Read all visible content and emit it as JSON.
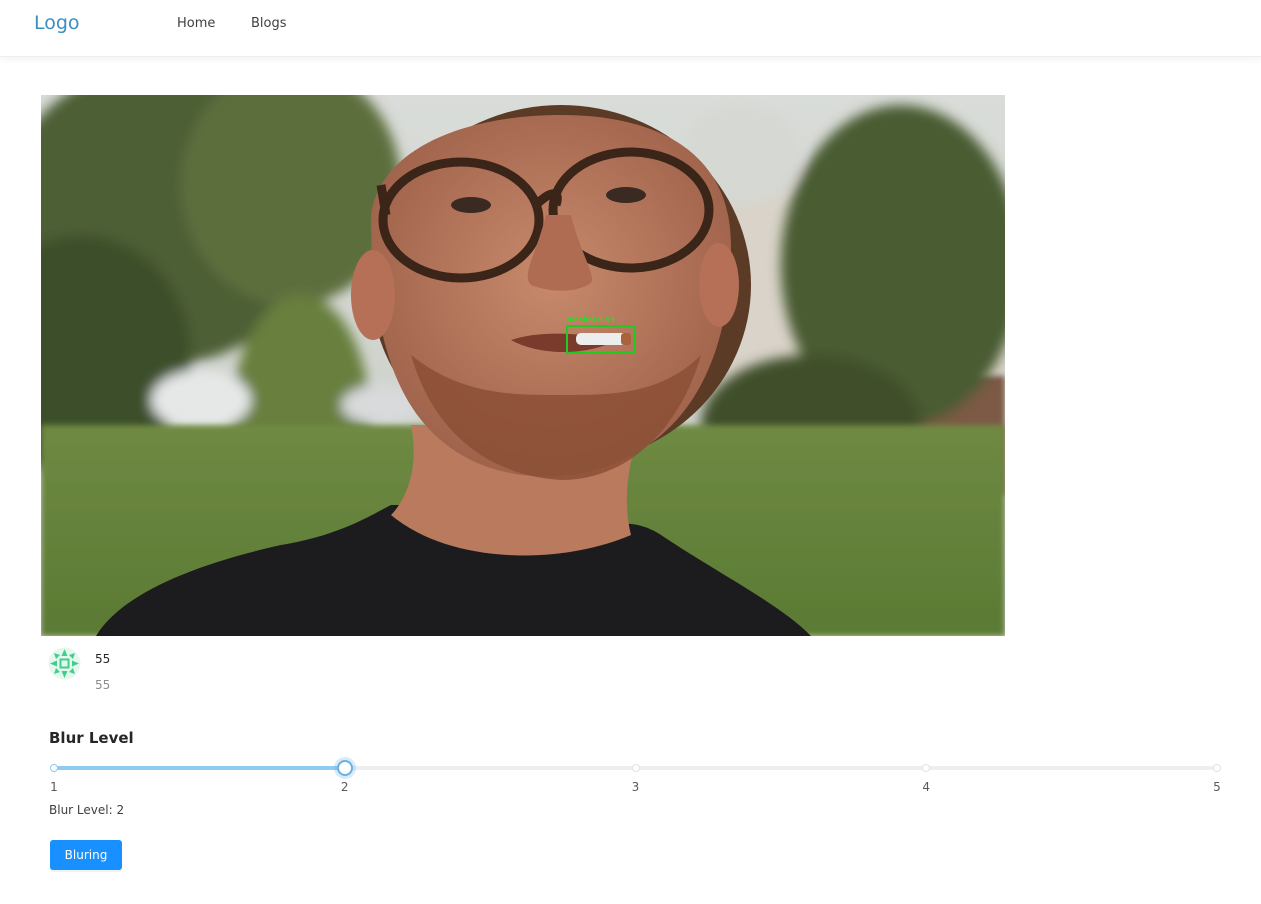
{
  "header": {
    "logo": "Logo",
    "nav": [
      "Home",
      "Blogs"
    ]
  },
  "video": {
    "detection": {
      "label": "alcohol 0.93",
      "box_color": "#22c922"
    }
  },
  "meta": {
    "title": "55",
    "description": "55",
    "avatar_icon": "green-geometric-avatar-icon"
  },
  "blur": {
    "heading": "Blur Level",
    "min": 1,
    "max": 5,
    "value": 2,
    "marks": [
      "1",
      "2",
      "3",
      "4",
      "5"
    ],
    "value_text": "Blur Level: 2"
  },
  "actions": {
    "submit_label": "Bluring"
  },
  "colors": {
    "logo": "#3a8fc2",
    "primary": "#1890ff",
    "slider_track": "#91caf0"
  }
}
